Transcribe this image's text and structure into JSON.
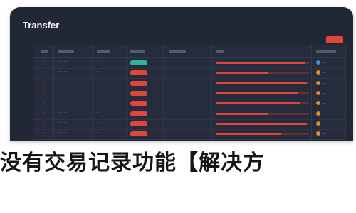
{
  "window": {
    "title": "Transfer",
    "accent_color": "#e0463a",
    "bg_color": "#222735"
  },
  "table": {
    "rows": [
      {
        "num": "≡",
        "date": "—— ——",
        "name": "——",
        "status": "green",
        "progress": 0.96,
        "badge_color": "#4c8ad8",
        "badge": "—"
      },
      {
        "num": "≡",
        "date": "—— ——",
        "name": "——",
        "status": "red",
        "progress": 0.55,
        "badge_color": "#e08a2c",
        "badge": "—"
      },
      {
        "num": "≡",
        "date": "—— ——",
        "name": "——",
        "status": "red",
        "progress": 0.98,
        "badge_color": "#e08a2c",
        "badge": "—"
      },
      {
        "num": "≡",
        "date": "—— ——",
        "name": "——",
        "status": "red",
        "progress": 0.88,
        "badge_color": "#e08a2c",
        "badge": "—"
      },
      {
        "num": "≡",
        "date": "—— ——",
        "name": "——",
        "status": "red",
        "progress": 0.9,
        "badge_color": "#e08a2c",
        "badge": "—"
      },
      {
        "num": "≡",
        "date": "—— ——",
        "name": "——",
        "status": "red",
        "progress": 0.55,
        "badge_color": "#e08a2c",
        "badge": "—"
      },
      {
        "num": "≡",
        "date": "—— ——",
        "name": "——",
        "status": "red",
        "progress": 0.98,
        "badge_color": "#e08a2c",
        "badge": "—"
      },
      {
        "num": "≡",
        "date": "—— ——",
        "name": "——",
        "status": "red",
        "progress": 0.7,
        "badge_color": "#e08a2c",
        "badge": "—"
      }
    ]
  },
  "colors": {
    "status_green": "#2fb4a0",
    "status_red": "#e0463a",
    "fill_red": "#e0463a"
  },
  "caption": {
    "text": "没有交易记录功能【解决方"
  }
}
